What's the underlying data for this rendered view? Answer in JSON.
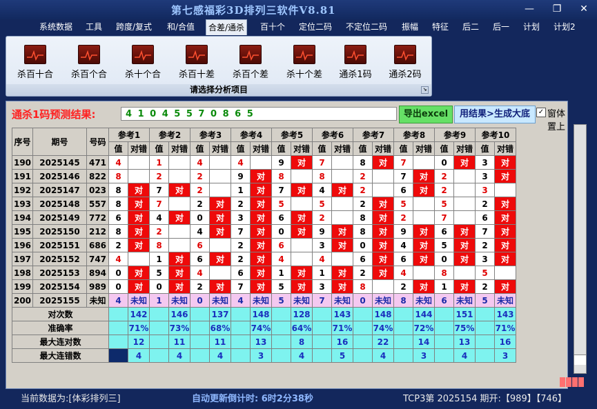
{
  "window": {
    "title": "第七感福彩3D排列三软件V8.81"
  },
  "menu": [
    "系统数据",
    "工具",
    "跨度/复式",
    "和/合值",
    "合差/通杀",
    "百十个",
    "定位二码",
    "不定位二码",
    "振幅",
    "特征",
    "后二",
    "后一",
    "计划",
    "计划2"
  ],
  "ribbon": {
    "buttons": [
      "杀百十合",
      "杀百个合",
      "杀十个合",
      "杀百十差",
      "杀百个差",
      "杀十个差",
      "通杀1码",
      "通杀2码"
    ],
    "caption": "请选择分析项目"
  },
  "prediction": {
    "label": "通杀1码预测结果:",
    "value": "4 1 0 4 5 5 7 0 8 6 5",
    "excel_button": "导出excel",
    "sort_button": "用结果>生成大底",
    "topmost_label": "窗体置上"
  },
  "table": {
    "col_headers": {
      "seq": "序号",
      "period": "期号",
      "number": "号码",
      "value": "值",
      "hit": "对错"
    },
    "ref_headers": [
      "参考1",
      "参考2",
      "参考3",
      "参考4",
      "参考5",
      "参考6",
      "参考7",
      "参考8",
      "参考9",
      "参考10"
    ],
    "rows": [
      {
        "seq": "190",
        "period": "2025145",
        "num": "471",
        "vals": [
          "4",
          "1",
          "4",
          "4",
          "9",
          "7",
          "8",
          "7",
          "0",
          "3"
        ],
        "hits": [
          "",
          "",
          "",
          "",
          "对",
          "",
          "对",
          "",
          "对",
          "对"
        ]
      },
      {
        "seq": "191",
        "period": "2025146",
        "num": "822",
        "vals": [
          "8",
          "2",
          "2",
          "9",
          "8",
          "8",
          "2",
          "7",
          "2",
          "3"
        ],
        "hits": [
          "",
          "",
          "",
          "对",
          "",
          "",
          "",
          "对",
          "",
          "对"
        ]
      },
      {
        "seq": "192",
        "period": "2025147",
        "num": "023",
        "vals": [
          "8",
          "7",
          "2",
          "1",
          "7",
          "4",
          "2",
          "6",
          "2",
          "3"
        ],
        "hits": [
          "对",
          "对",
          "",
          "对",
          "对",
          "对",
          "",
          "对",
          "",
          ""
        ]
      },
      {
        "seq": "193",
        "period": "2025148",
        "num": "557",
        "vals": [
          "8",
          "7",
          "2",
          "2",
          "5",
          "5",
          "2",
          "5",
          "5",
          "2"
        ],
        "hits": [
          "对",
          "",
          "对",
          "对",
          "",
          "",
          "对",
          "",
          "",
          "对"
        ]
      },
      {
        "seq": "194",
        "period": "2025149",
        "num": "772",
        "vals": [
          "6",
          "4",
          "0",
          "3",
          "6",
          "2",
          "8",
          "2",
          "7",
          "6"
        ],
        "hits": [
          "对",
          "对",
          "对",
          "对",
          "对",
          "",
          "对",
          "",
          "",
          "对"
        ]
      },
      {
        "seq": "195",
        "period": "2025150",
        "num": "212",
        "vals": [
          "8",
          "2",
          "4",
          "7",
          "0",
          "9",
          "8",
          "9",
          "6",
          "7"
        ],
        "hits": [
          "对",
          "",
          "对",
          "对",
          "对",
          "对",
          "对",
          "对",
          "对",
          "对"
        ]
      },
      {
        "seq": "196",
        "period": "2025151",
        "num": "686",
        "vals": [
          "2",
          "8",
          "6",
          "2",
          "6",
          "3",
          "0",
          "4",
          "5",
          "2"
        ],
        "hits": [
          "对",
          "",
          "",
          "对",
          "",
          "对",
          "对",
          "对",
          "对",
          "对"
        ]
      },
      {
        "seq": "197",
        "period": "2025152",
        "num": "747",
        "vals": [
          "4",
          "1",
          "6",
          "2",
          "4",
          "4",
          "6",
          "6",
          "0",
          "3"
        ],
        "hits": [
          "",
          "对",
          "对",
          "对",
          "",
          "",
          "对",
          "对",
          "对",
          "对"
        ]
      },
      {
        "seq": "198",
        "period": "2025153",
        "num": "894",
        "vals": [
          "0",
          "5",
          "4",
          "6",
          "1",
          "1",
          "2",
          "4",
          "8",
          "5"
        ],
        "hits": [
          "对",
          "对",
          "",
          "对",
          "对",
          "对",
          "对",
          "",
          "",
          ""
        ]
      },
      {
        "seq": "199",
        "period": "2025154",
        "num": "989",
        "vals": [
          "0",
          "0",
          "2",
          "7",
          "5",
          "3",
          "8",
          "2",
          "1",
          "2"
        ],
        "hits": [
          "对",
          "对",
          "对",
          "对",
          "对",
          "对",
          "",
          "对",
          "对",
          "对"
        ]
      }
    ],
    "pending": {
      "seq": "200",
      "period": "2025155",
      "num": "未知",
      "vals": [
        "4",
        "1",
        "0",
        "4",
        "5",
        "7",
        "0",
        "8",
        "6",
        "5"
      ],
      "hit_label": "未知"
    },
    "summary": [
      {
        "label": "对次数",
        "values": [
          "142",
          "146",
          "137",
          "148",
          "128",
          "143",
          "148",
          "144",
          "151",
          "143"
        ]
      },
      {
        "label": "准确率",
        "values": [
          "71%",
          "73%",
          "68%",
          "74%",
          "64%",
          "71%",
          "74%",
          "72%",
          "75%",
          "71%"
        ]
      },
      {
        "label": "最大连对数",
        "values": [
          "12",
          "11",
          "11",
          "13",
          "8",
          "16",
          "22",
          "14",
          "13",
          "16"
        ]
      },
      {
        "label": "最大连错数",
        "values": [
          "4",
          "4",
          "4",
          "3",
          "4",
          "5",
          "4",
          "3",
          "4",
          "3"
        ]
      }
    ]
  },
  "status": {
    "current_data": "当前数据为:[体彩排列三]",
    "countdown": "自动更新倒计时:  6时2分38秒",
    "latest": "TCP3第 2025154 期开:【989】【746】"
  },
  "colors": {
    "hit": "#ee0a0a",
    "pending": "#f4c8f0",
    "summary": "#7ef3ef",
    "background": "#13275c"
  }
}
